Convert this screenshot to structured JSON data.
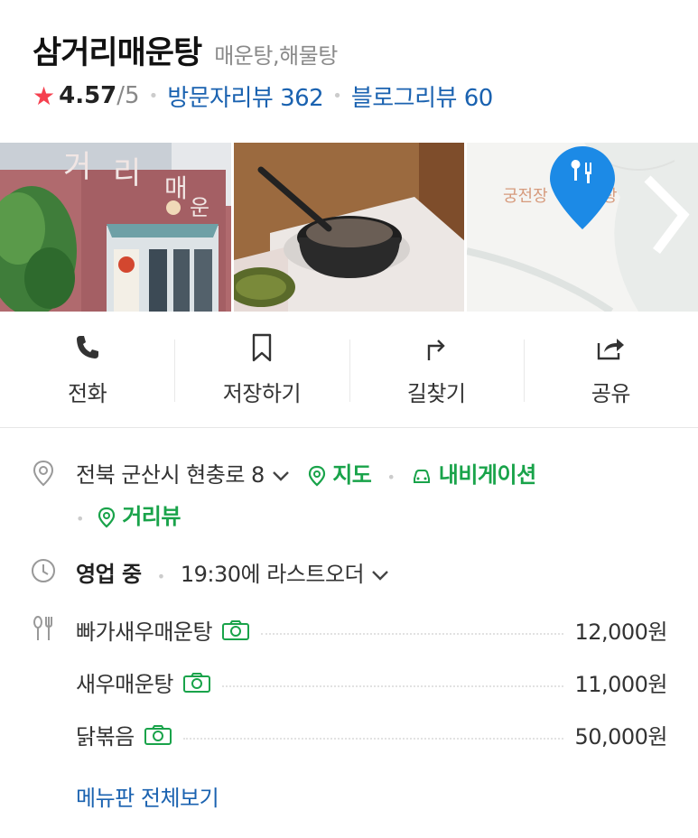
{
  "place": {
    "name": "삼거리매운탕",
    "category": "매운탕,해물탕",
    "rating": "4.57",
    "rating_max": "/5",
    "visitor_reviews": "방문자리뷰 362",
    "blog_reviews": "블로그리뷰 60"
  },
  "photos": {
    "map_label": "궁전장",
    "map_label_tail": "탕"
  },
  "actions": [
    {
      "label": "전화",
      "icon": "phone-icon"
    },
    {
      "label": "저장하기",
      "icon": "bookmark-icon"
    },
    {
      "label": "길찾기",
      "icon": "directions-icon"
    },
    {
      "label": "공유",
      "icon": "share-icon"
    }
  ],
  "address": {
    "text": "전북 군산시 현충로 8",
    "map_link": "지도",
    "navi_link": "내비게이션",
    "street_link": "거리뷰"
  },
  "hours": {
    "status": "영업 중",
    "last_order": "19:30에 라스트오더"
  },
  "menu": {
    "items": [
      {
        "name": "빠가새우매운탕",
        "price": "12,000원"
      },
      {
        "name": "새우매운탕",
        "price": "11,000원"
      },
      {
        "name": "닭볶음",
        "price": "50,000원"
      }
    ],
    "more": "메뉴판 전체보기"
  },
  "colors": {
    "link_blue": "#1a62b0",
    "green": "#19a34a",
    "star_red": "#f5404f",
    "map_pin_blue": "#1c8ae6"
  }
}
